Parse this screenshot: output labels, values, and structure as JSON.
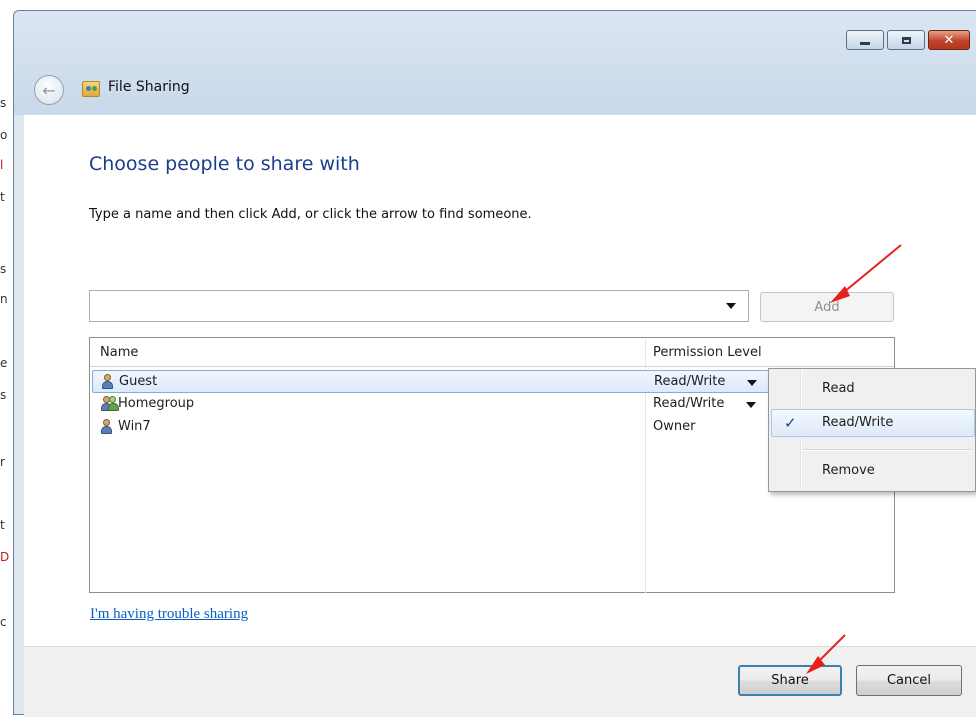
{
  "window": {
    "title": "File Sharing",
    "caption_buttons": [
      "minimize-icon",
      "maximize-icon",
      "close-icon"
    ]
  },
  "main": {
    "heading": "Choose people to share with",
    "instruction": "Type a name and then click Add, or click the arrow to find someone.",
    "name_input": {
      "value": "",
      "placeholder": ""
    },
    "add_label": "Add",
    "columns": {
      "name": "Name",
      "permission": "Permission Level"
    },
    "rows": [
      {
        "name": "Guest",
        "permission": "Read/Write",
        "icon": "user-icon",
        "selected": true
      },
      {
        "name": "Homegroup",
        "permission": "Read/Write",
        "icon": "group-icon",
        "selected": false
      },
      {
        "name": "Win7",
        "permission": "Owner",
        "icon": "user-icon",
        "selected": false
      }
    ],
    "trouble_link": "I'm having trouble sharing"
  },
  "popup_menu": {
    "items": [
      {
        "label": "Read",
        "checked": false
      },
      {
        "label": "Read/Write",
        "checked": true
      },
      {
        "label": "Remove",
        "checked": false
      }
    ],
    "check_glyph": "✓"
  },
  "footer": {
    "share_label": "Share",
    "cancel_label": "Cancel"
  },
  "colors": {
    "heading": "#1a3e8c",
    "link": "#0a5fc2",
    "annotation_arrow": "#e8201a"
  }
}
